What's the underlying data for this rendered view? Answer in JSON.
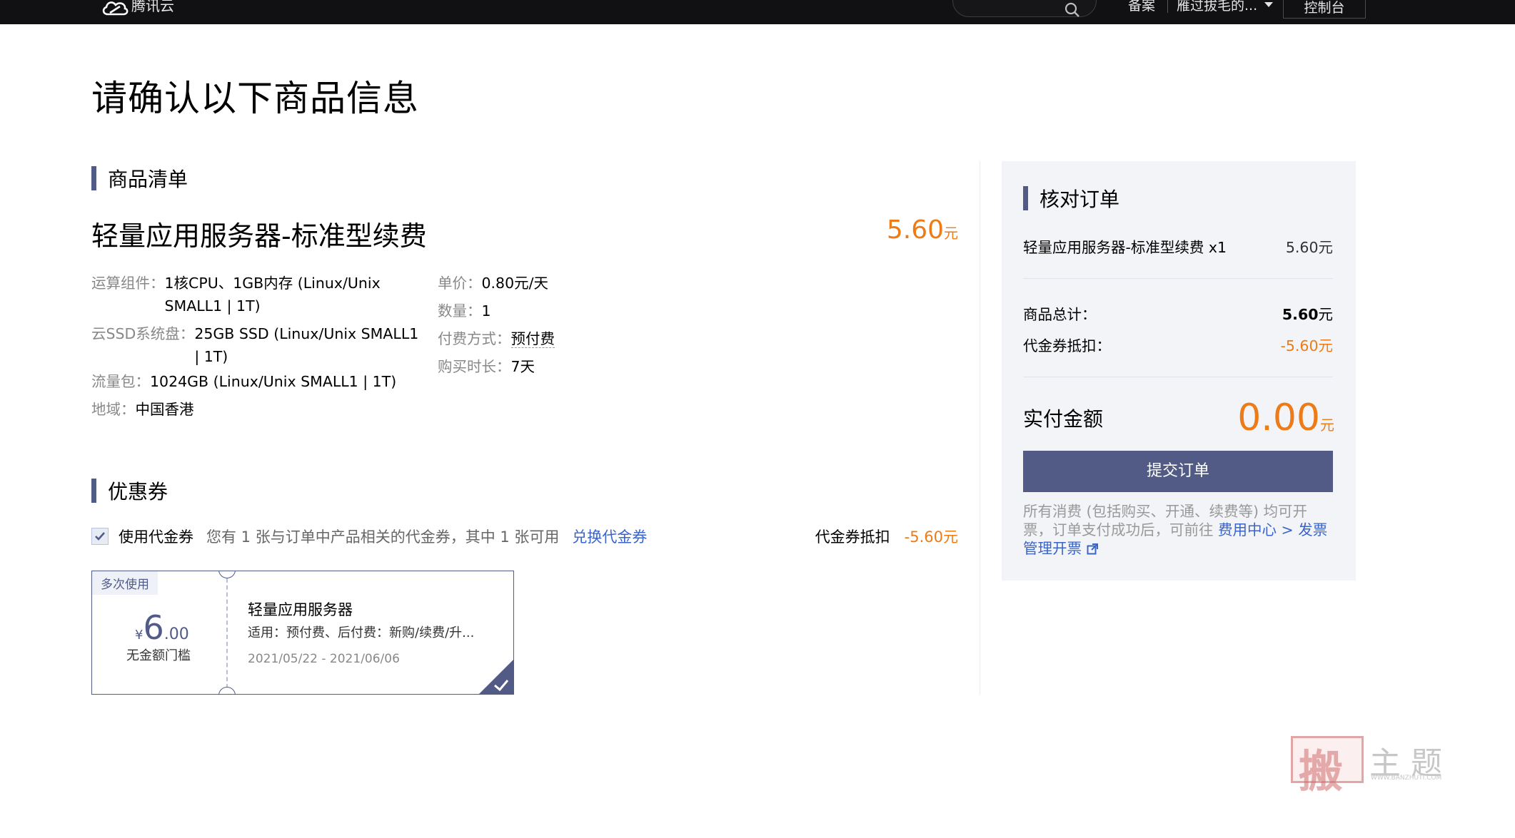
{
  "nav": {
    "brand": "腾讯云",
    "beian": "备案",
    "user": "雁过拔毛的...",
    "console": "控制台"
  },
  "page_title": "请确认以下商品信息",
  "product_section": {
    "heading": "商品清单",
    "name": "轻量应用服务器-标准型续费",
    "price": "5.60",
    "price_unit": "元",
    "specs_left": [
      {
        "key": "运算组件：",
        "value": "1核CPU、1GB内存 (Linux/Unix SMALL1 | 1T)"
      },
      {
        "key": "云SSD系统盘：",
        "value": "25GB SSD (Linux/Unix SMALL1 | 1T)"
      },
      {
        "key": "流量包：",
        "value": "1024GB (Linux/Unix SMALL1 | 1T)"
      },
      {
        "key": "地域：",
        "value": "中国香港"
      }
    ],
    "specs_right": [
      {
        "key": "单价：",
        "value": "0.80元/天"
      },
      {
        "key": "数量：",
        "value": "1"
      },
      {
        "key": "付费方式：",
        "value": "预付费"
      },
      {
        "key": "购买时长：",
        "value": "7天"
      }
    ]
  },
  "coupon_section": {
    "heading": "优惠券",
    "use_label": "使用代金券",
    "checked": true,
    "description": "您有 1 张与订单中产品相关的代金券，其中 1 张可用",
    "exchange_link": "兑换代金券",
    "deduct_label": "代金券抵扣",
    "deduct_amount": "-5.60元",
    "card": {
      "tag": "多次使用",
      "currency": "¥",
      "amount_int": "6",
      "amount_dec": ".00",
      "threshold": "无金额门槛",
      "product": "轻量应用服务器",
      "scope": "适用：预付费、后付费：新购/续费/升...",
      "dates": "2021/05/22 - 2021/06/06",
      "selected": true
    }
  },
  "summary": {
    "heading": "核对订单",
    "item_name": "轻量应用服务器-标准型续费 x1",
    "item_price": "5.60元",
    "total_label": "商品总计：",
    "total_value": "5.60",
    "total_unit": "元",
    "coupon_label": "代金券抵扣：",
    "coupon_value": "-5.60元",
    "pay_label": "实付金额",
    "pay_amount": "0.00",
    "pay_unit": "元",
    "submit": "提交订单",
    "note_prefix": "所有消费 (包括购买、开通、续费等) 均可开票，订单支付成功后，可前往 ",
    "note_link": "费用中心 > 发票管理开票"
  },
  "watermark": {
    "seal": "搬",
    "text": "主题",
    "url": "WWW.BANZHUTI.COM"
  },
  "colors": {
    "accent": "#525b86",
    "price": "#ed7b18",
    "link": "#3b64c7",
    "nav_bg": "#111114",
    "summary_bg": "#f3f4f7"
  }
}
